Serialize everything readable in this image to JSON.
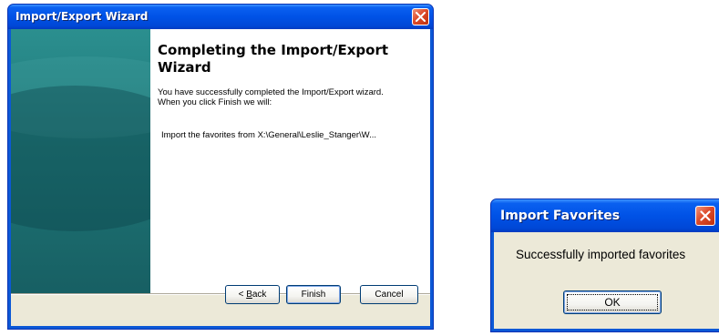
{
  "wizard": {
    "title": "Import/Export Wizard",
    "heading": "Completing the Import/Export Wizard",
    "intro": "You have successfully completed the Import/Export wizard.  When you click Finish we will:",
    "action": "Import the favorites from X:\\General\\Leslie_Stanger\\W...",
    "buttons": {
      "back_mnemonic": "B",
      "back_rest": "ack",
      "back_prefix": "< ",
      "finish": "Finish",
      "cancel": "Cancel"
    },
    "close_icon": "close-icon"
  },
  "dialog": {
    "title": "Import Favorites",
    "message": "Successfully imported favorites",
    "ok": "OK",
    "close_icon": "close-icon"
  },
  "colors": {
    "titlebar": "#0052e6",
    "face": "#ece9d8",
    "close": "#dd4b2a",
    "side_panel": "#1f7676"
  }
}
